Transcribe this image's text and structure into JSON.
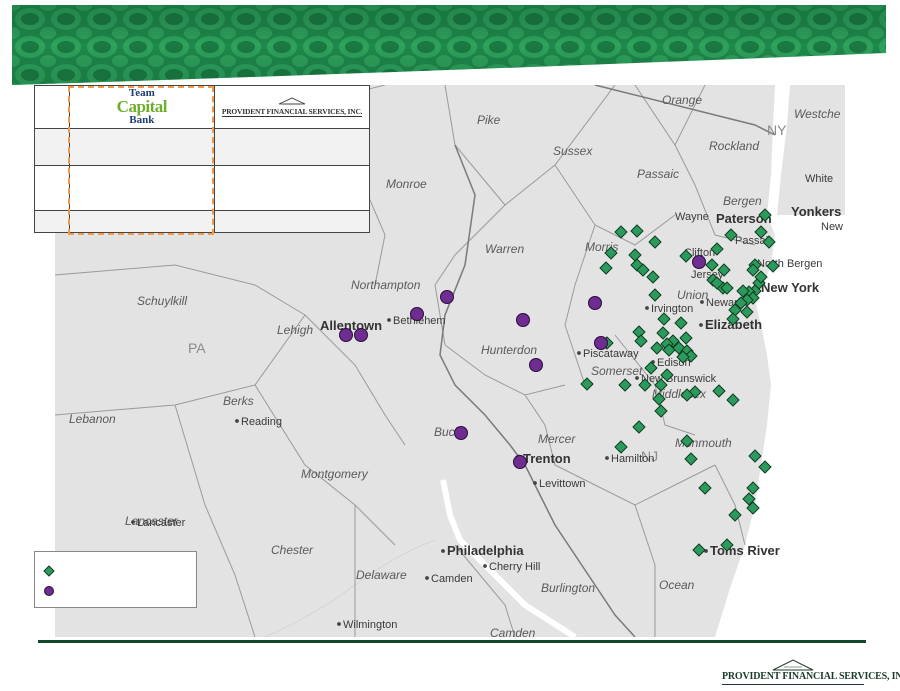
{
  "colors": {
    "banner_green": "#1f8a4c",
    "map_base": "#e3e3e3",
    "water": "#ffffff",
    "provident_branch": "#2c9a5c",
    "team_capital_branch": "#6f2c91",
    "highlight_dash": "#f29a4a"
  },
  "header": {
    "team_capital_logo": {
      "line1": "Team",
      "line2": "Capital",
      "line3": "Bank"
    },
    "provident_logo": "PROVIDENT FINANCIAL SERVICES, INC."
  },
  "footer": {
    "logo_text": "PROVIDENT FINANCIAL SERVICES, INC."
  },
  "legend": {
    "items": [
      {
        "icon": "green-diamond",
        "label": ""
      },
      {
        "icon": "purple-circle",
        "label": ""
      }
    ]
  },
  "map": {
    "state_labels": [
      "NY",
      "PA",
      "NJ"
    ],
    "county_labels": [
      "Orange",
      "Westche",
      "Pike",
      "Sussex",
      "Rockland",
      "Passaic",
      "Bergen",
      "Monroe",
      "Warren",
      "Morris",
      "Northampton",
      "Lehigh",
      "Schuylkill",
      "Hunterdon",
      "Union",
      "Somerset",
      "Middlesex",
      "Berks",
      "Lebanon",
      "Bucks",
      "Mercer",
      "Monmouth",
      "Montgomery",
      "Lancaster",
      "Chester",
      "Delaware",
      "Burlington",
      "Ocean",
      "Camden"
    ],
    "city_labels": [
      "White",
      "Yonkers",
      "New",
      "Wayne",
      "Paterson",
      "Clifton",
      "Passaic",
      "Jersey",
      "North Bergen",
      "New York",
      "Irvington",
      "Newark",
      "Elizabeth",
      "Allentown",
      "Bethlehem",
      "Piscataway",
      "Edison",
      "New Brunswick",
      "Reading",
      "Trenton",
      "Hamilton",
      "Levittown",
      "Lancaster",
      "Philadelphia",
      "Cherry Hill",
      "Camden",
      "Toms River",
      "Wilmington"
    ]
  }
}
